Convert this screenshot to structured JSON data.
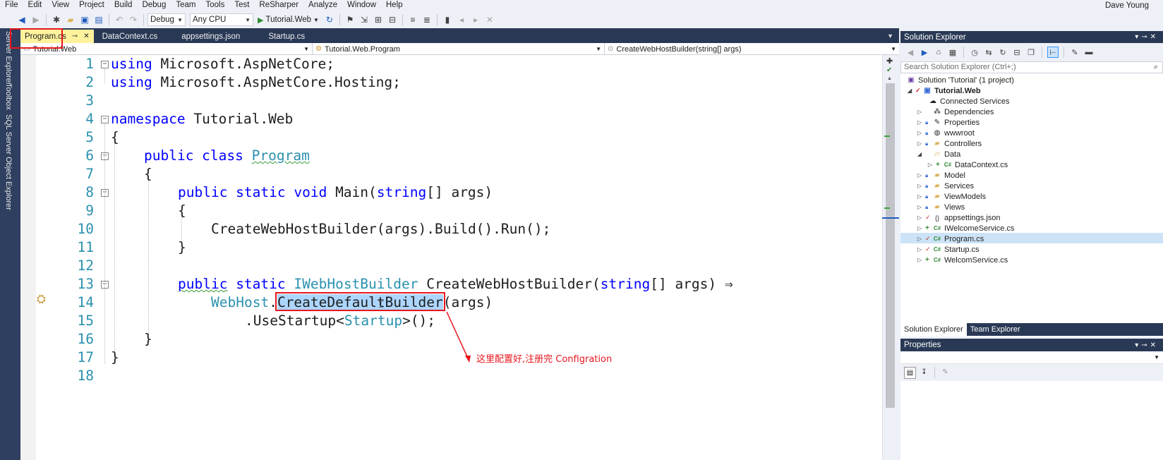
{
  "menu": [
    "File",
    "Edit",
    "View",
    "Project",
    "Build",
    "Debug",
    "Team",
    "Tools",
    "Test",
    "ReSharper",
    "Analyze",
    "Window",
    "Help"
  ],
  "user": "Dave Young",
  "toolbar": {
    "config": "Debug",
    "platform": "Any CPU",
    "run_target": "Tutorial.Web"
  },
  "left_tabs": [
    "Server Explorer",
    "Toolbox",
    "SQL Server Object Explorer"
  ],
  "tabs": [
    {
      "label": "Program.cs",
      "active": true
    },
    {
      "label": "DataContext.cs",
      "active": false
    },
    {
      "label": "appsettings.json",
      "active": false
    },
    {
      "label": "Startup.cs",
      "active": false
    }
  ],
  "navbar": {
    "project": "Tutorial.Web",
    "type": "Tutorial.Web.Program",
    "member": "CreateWebHostBuilder(string[] args)"
  },
  "code": {
    "line_numbers": [
      "1",
      "2",
      "3",
      "4",
      "5",
      "6",
      "7",
      "8",
      "9",
      "10",
      "11",
      "12",
      "13",
      "14",
      "15",
      "16",
      "17",
      "18"
    ],
    "l1_kw": "using",
    "l1_rest": " Microsoft.AspNetCore;",
    "l2_kw": "using",
    "l2_rest": " Microsoft.AspNetCore.Hosting;",
    "l4_kw": "namespace",
    "l4_rest": " Tutorial.Web",
    "open_brace": "{",
    "close_brace": "}",
    "l6_kw": "public class",
    "l6_type": "Program",
    "l8_kw": "public static void",
    "l8_mid": " Main(",
    "l8_kw2": "string",
    "l8_rest": "[] args)",
    "l10_text": "CreateWebHostBuilder(args).Build().Run();",
    "l13_kw": "public",
    "l13_kw2": " static ",
    "l13_type": "IWebHostBuilder",
    "l13_mid": " CreateWebHostBuilder(",
    "l13_kw3": "string",
    "l13_rest": "[] args) ⇒",
    "l14_type": "WebHost",
    "l14_dot": ".",
    "l14_sel": "CreateDefaultBuilder",
    "l14_rest": "(args)",
    "l15_a": ".UseStartup<",
    "l15_type": "Startup",
    "l15_b": ">();"
  },
  "annotation": "这里配置好,注册完 Configration",
  "solution_explorer": {
    "title": "Solution Explorer",
    "search_placeholder": "Search Solution Explorer (Ctrl+;)",
    "items": [
      {
        "label": "Solution 'Tutorial' (1 project)"
      },
      {
        "label": "Tutorial.Web"
      },
      {
        "label": "Connected Services"
      },
      {
        "label": "Dependencies"
      },
      {
        "label": "Properties"
      },
      {
        "label": "wwwroot"
      },
      {
        "label": "Controllers"
      },
      {
        "label": "Data"
      },
      {
        "label": "DataContext.cs"
      },
      {
        "label": "Model"
      },
      {
        "label": "Services"
      },
      {
        "label": "ViewModels"
      },
      {
        "label": "Views"
      },
      {
        "label": "appsettings.json"
      },
      {
        "label": "IWelcomeService.cs"
      },
      {
        "label": "Program.cs"
      },
      {
        "label": "Startup.cs"
      },
      {
        "label": "WelcomService.cs"
      }
    ],
    "tab_se": "Solution Explorer",
    "tab_te": "Team Explorer"
  },
  "properties": {
    "title": "Properties"
  },
  "colors": {
    "frame": "#293955",
    "active_tab": "#fff29d",
    "keyword": "#0000ff",
    "type": "#2b91af",
    "annotation": "#e8161d"
  }
}
